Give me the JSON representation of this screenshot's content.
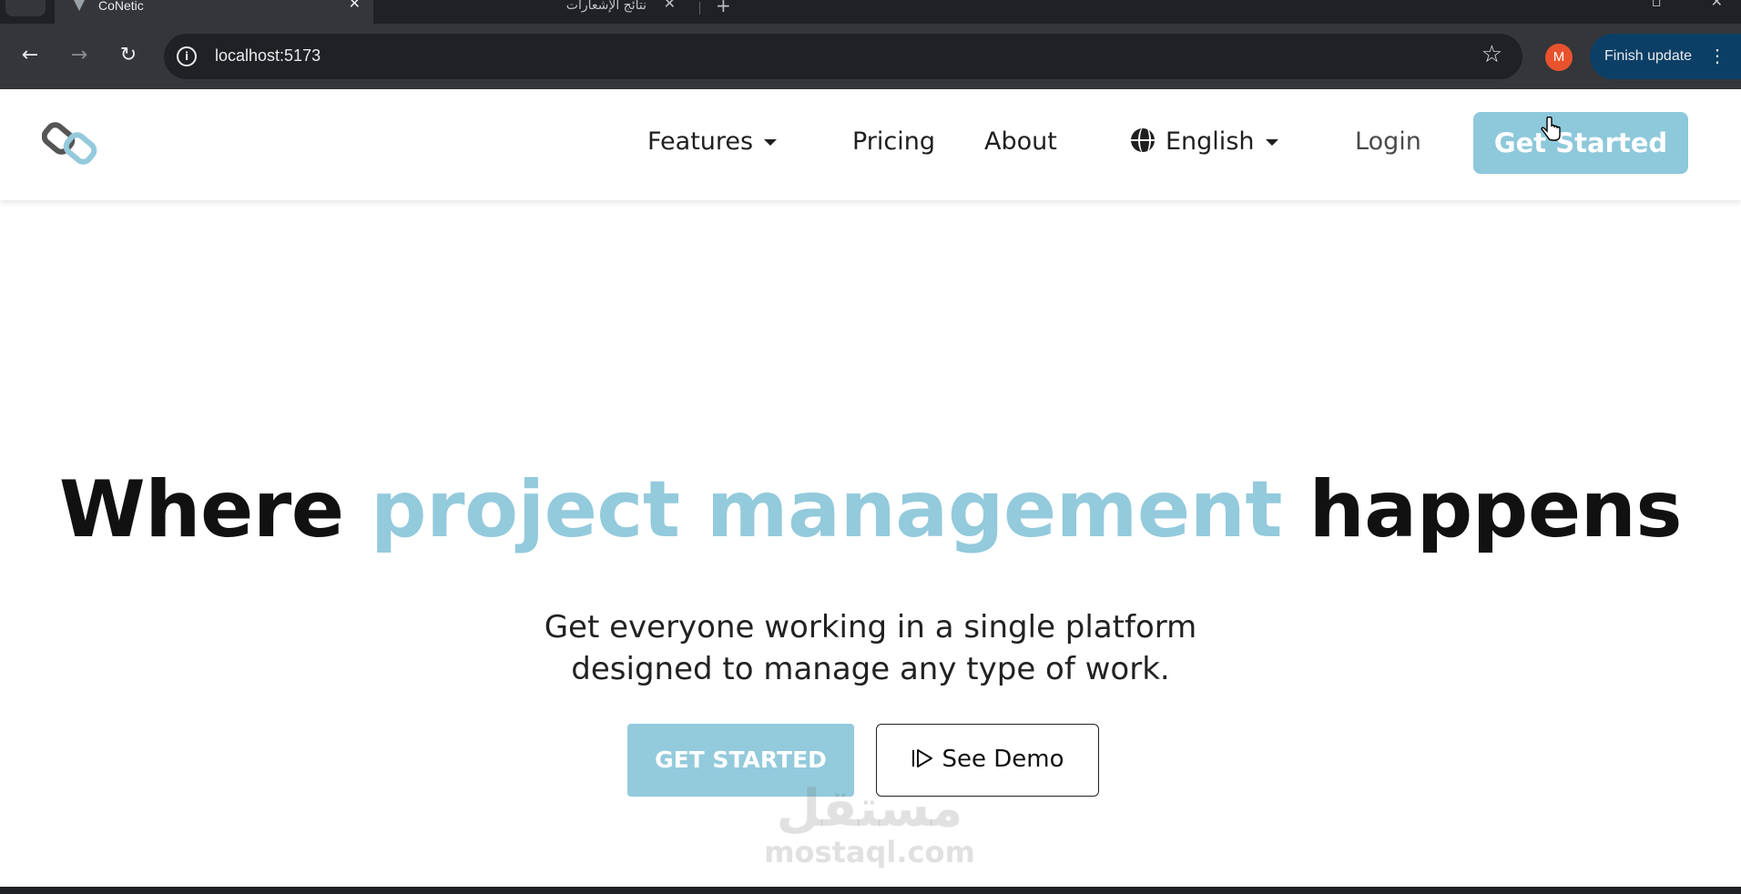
{
  "browser": {
    "tabs": [
      {
        "title": "CoNetic",
        "active": true
      },
      {
        "title": "نتائج الإشعارات",
        "active": false
      }
    ],
    "new_tab_icon": "plus-icon",
    "url": "localhost:5173",
    "profile_initial": "M",
    "profile_color": "#e8532d",
    "finish_update_label": "Finish update"
  },
  "site": {
    "nav": {
      "features": "Features",
      "pricing": "Pricing",
      "about": "About",
      "language": "English",
      "login": "Login",
      "get_started": "Get Started"
    },
    "hero": {
      "title_before": "Where",
      "title_accent": "project management",
      "title_after": "happens",
      "subtitle_line1": "Get everyone working in a single platform",
      "subtitle_line2": "designed to manage any type of work.",
      "cta_primary": "GET STARTED",
      "cta_secondary": "See Demo"
    },
    "accent_color": "#93cadc"
  },
  "watermark": {
    "arabic": "مستقل",
    "latin": "mostaql.com"
  }
}
